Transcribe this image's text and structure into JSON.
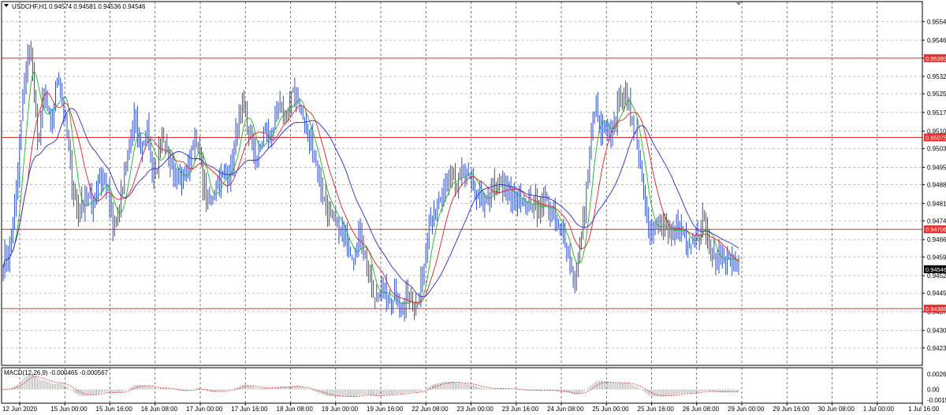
{
  "chart_data": [
    {
      "type": "candlestick",
      "symbol_line": "USDCHF,H1  0.94574 0.94581 0.94536 0.94546",
      "current_price": "0.94546",
      "colors": {
        "background": "#ffffff",
        "candle": "#2f4fc9",
        "ma_fast": "#22b422",
        "ma_mid": "#e02020",
        "ma_slow": "#2a2ad0",
        "hline": "#e83030",
        "grid": "#b8b8b8",
        "axis": "#000000",
        "current_bg": "#000000"
      },
      "ylim": [
        0.9416,
        0.9562
      ],
      "y_ticks": [
        "0.95540",
        "0.95465",
        "0.95393",
        "0.95320",
        "0.95250",
        "0.95175",
        "0.95100",
        "0.95030",
        "0.94955",
        "0.94885",
        "0.94810",
        "0.94740",
        "0.94665",
        "0.94595",
        "0.94520",
        "0.94450",
        "0.94375",
        "0.94300",
        "0.94230"
      ],
      "x_labels": [
        "12 Jun 2020",
        "15 Jun 00:00",
        "15 Jun 16:00",
        "16 Jun 08:00",
        "17 Jun 00:00",
        "17 Jun 16:00",
        "18 Jun 08:00",
        "19 Jun 00:00",
        "19 Jun 16:00",
        "22 Jun 08:00",
        "23 Jun 00:00",
        "23 Jun 16:00",
        "24 Jun 08:00",
        "25 Jun 00:00",
        "25 Jun 16:00",
        "26 Jun 08:00",
        "29 Jun 00:00",
        "29 Jun 16:00",
        "30 Jun 08:00",
        "1 Jul 00:00",
        "1 Jul 16:00"
      ],
      "horizontal_levels": [
        {
          "value": 0.95393,
          "label": "0.95393"
        },
        {
          "value": 0.95075,
          "label": "0.95075"
        },
        {
          "value": 0.94706,
          "label": "0.94706"
        },
        {
          "value": 0.94388,
          "label": "0.94388"
        }
      ],
      "price_path_anchors": [
        0.9458,
        0.9462,
        0.9486,
        0.953,
        0.9545,
        0.9505,
        0.9525,
        0.951,
        0.9535,
        0.9515,
        0.949,
        0.9475,
        0.9485,
        0.948,
        0.9492,
        0.9488,
        0.947,
        0.948,
        0.95,
        0.9515,
        0.9505,
        0.951,
        0.949,
        0.9505,
        0.95,
        0.9495,
        0.949,
        0.9495,
        0.951,
        0.949,
        0.948,
        0.949,
        0.9492,
        0.9494,
        0.951,
        0.952,
        0.9505,
        0.95,
        0.951,
        0.9508,
        0.952,
        0.9515,
        0.9525,
        0.9522,
        0.951,
        0.9505,
        0.949,
        0.948,
        0.9475,
        0.947,
        0.9465,
        0.946,
        0.947,
        0.9455,
        0.944,
        0.945,
        0.944,
        0.9445,
        0.9438,
        0.9445,
        0.944,
        0.945,
        0.947,
        0.948,
        0.9485,
        0.949,
        0.9488,
        0.9495,
        0.949,
        0.9485,
        0.948,
        0.9485,
        0.949,
        0.9488,
        0.9482,
        0.9485,
        0.948,
        0.9482,
        0.9478,
        0.9482,
        0.9475,
        0.947,
        0.9465,
        0.945,
        0.9465,
        0.949,
        0.952,
        0.951,
        0.9508,
        0.9515,
        0.9525,
        0.952,
        0.951,
        0.949,
        0.947,
        0.9472,
        0.947,
        0.9468,
        0.9472,
        0.947,
        0.9465,
        0.947,
        0.9475,
        0.946,
        0.9458,
        0.946,
        0.9458,
        0.9455
      ],
      "indicators": [
        {
          "type": "ma",
          "period": 8,
          "color_key": "ma_fast"
        },
        {
          "type": "ma",
          "period": 16,
          "color_key": "ma_mid"
        },
        {
          "type": "ma",
          "period": 34,
          "color_key": "ma_slow"
        }
      ],
      "subchart": {
        "label": "MACD(12,26,9) -0.000465 -0.000567",
        "y_ticks": [
          "0.002688",
          "0.00",
          "-0.00155"
        ],
        "ylim": [
          -0.0019,
          0.003
        ]
      }
    }
  ]
}
